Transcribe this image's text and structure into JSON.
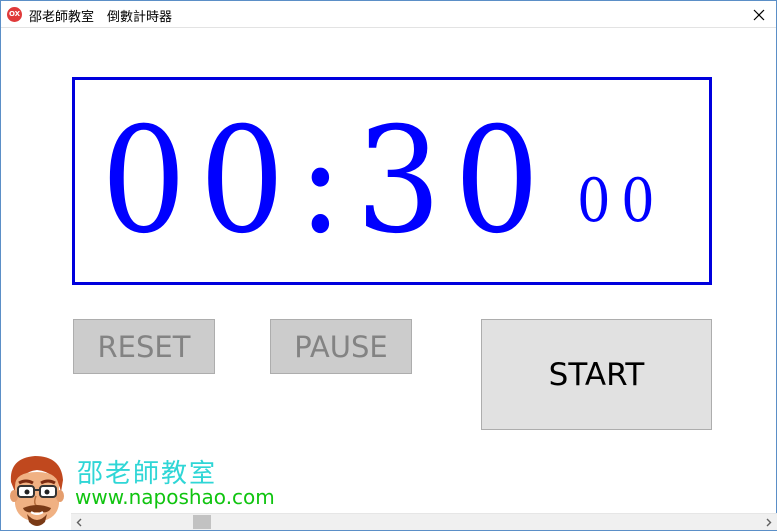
{
  "window": {
    "title": "邵老師教室　倒數計時器",
    "app_icon_label": "OX",
    "app_icon_color": "#e03a3a"
  },
  "timer": {
    "main": "00:30",
    "hundredths": "00",
    "color": "#0000ff"
  },
  "buttons": {
    "reset": "RESET",
    "pause": "PAUSE",
    "start": "START"
  },
  "branding": {
    "name": "邵老師教室",
    "url": "www.naposhao.com",
    "name_color": "#2fd6d6",
    "url_color": "#10c410"
  },
  "scrollbar": {
    "position": 0.16
  },
  "icons": {
    "close": "close-icon",
    "scroll_left": "chevron-left-icon",
    "scroll_right": "chevron-right-icon",
    "avatar": "teacher-avatar-illustration"
  }
}
